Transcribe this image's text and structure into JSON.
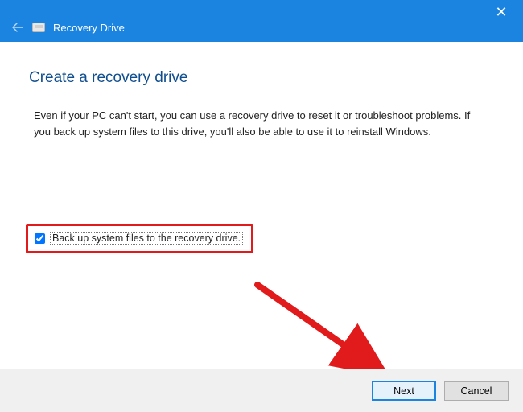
{
  "window": {
    "title": "Recovery Drive"
  },
  "main": {
    "heading": "Create a recovery drive",
    "description": "Even if your PC can't start, you can use a recovery drive to reset it or troubleshoot problems. If you back up system files to this drive, you'll also be able to use it to reinstall Windows."
  },
  "checkbox": {
    "label": "Back up system files to the recovery drive.",
    "checked": true
  },
  "footer": {
    "next": "Next",
    "cancel": "Cancel"
  }
}
